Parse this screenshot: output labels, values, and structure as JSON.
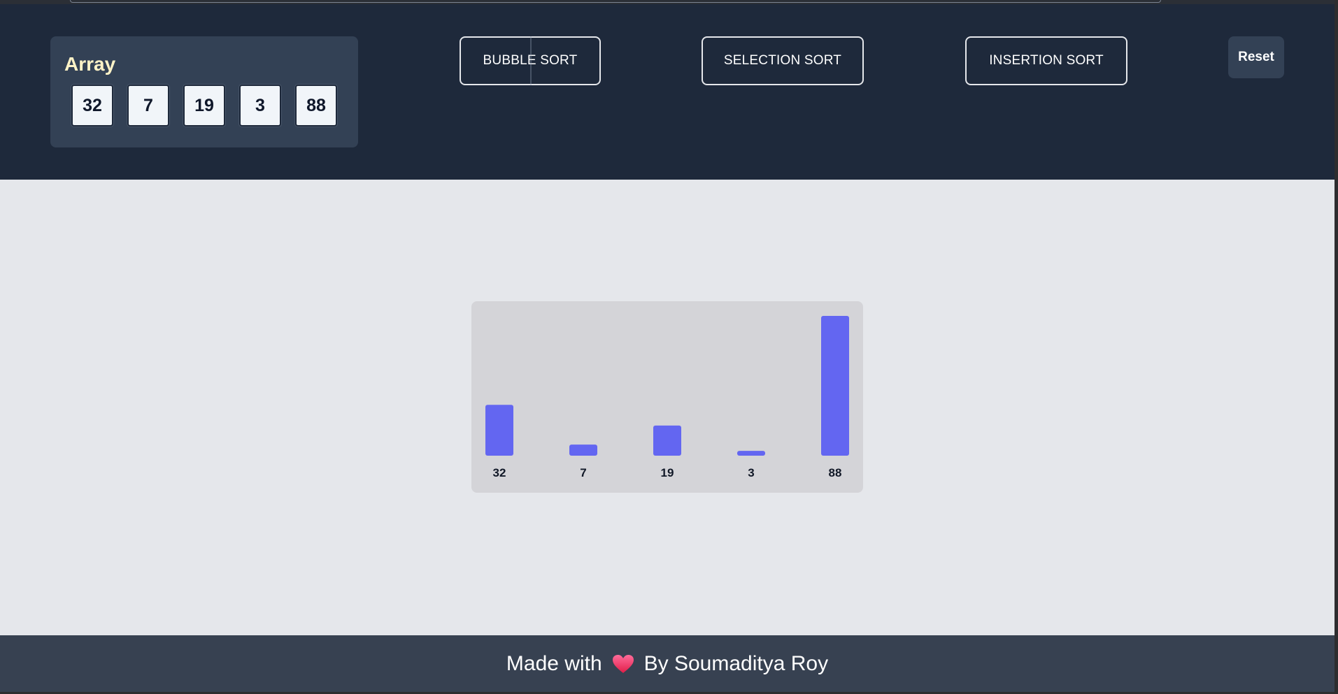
{
  "header": {
    "array_title": "Array",
    "array_values": [
      "32",
      "7",
      "19",
      "3",
      "88"
    ],
    "buttons": {
      "bubble": "BUBBLE SORT",
      "selection": "SELECTION SORT",
      "insertion": "INSERTION SORT",
      "reset": "Reset"
    }
  },
  "chart_data": {
    "type": "bar",
    "categories": [
      "32",
      "7",
      "19",
      "3",
      "88"
    ],
    "values": [
      32,
      7,
      19,
      3,
      88
    ],
    "bar_color": "#6366f1",
    "title": "",
    "xlabel": "",
    "ylabel": ""
  },
  "footer": {
    "text_before": "Made with",
    "icon": "heart-icon",
    "text_after": "By Soumaditya Roy"
  },
  "colors": {
    "header_bg": "#1e293b",
    "panel_bg": "#334155",
    "main_bg": "#e5e7eb",
    "chart_bg": "#d4d4d8",
    "bar": "#6366f1",
    "footer_bg": "#374151",
    "title_accent": "#fef3c7"
  }
}
